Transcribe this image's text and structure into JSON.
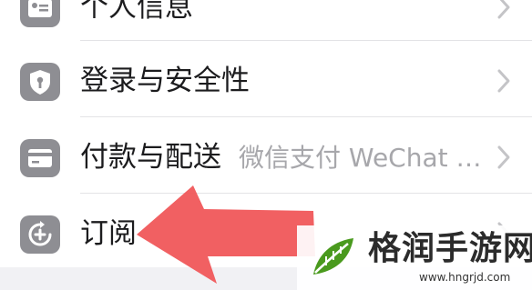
{
  "settings": {
    "rows": [
      {
        "label": "个人信息",
        "icon": "id-card-icon"
      },
      {
        "label": "登录与安全性",
        "icon": "shield-key-icon"
      },
      {
        "label": "付款与配送",
        "detail": "微信支付 WeChat Pay",
        "icon": "credit-card-icon"
      },
      {
        "label": "订阅",
        "icon": "subscription-icon"
      }
    ]
  },
  "watermark": {
    "title": "格润手游网",
    "url": "www.hngrjd.com"
  },
  "colors": {
    "icon_bg": "#8e8e93",
    "arrow": "#f0575a",
    "logo_green": "#4a9a1e"
  }
}
